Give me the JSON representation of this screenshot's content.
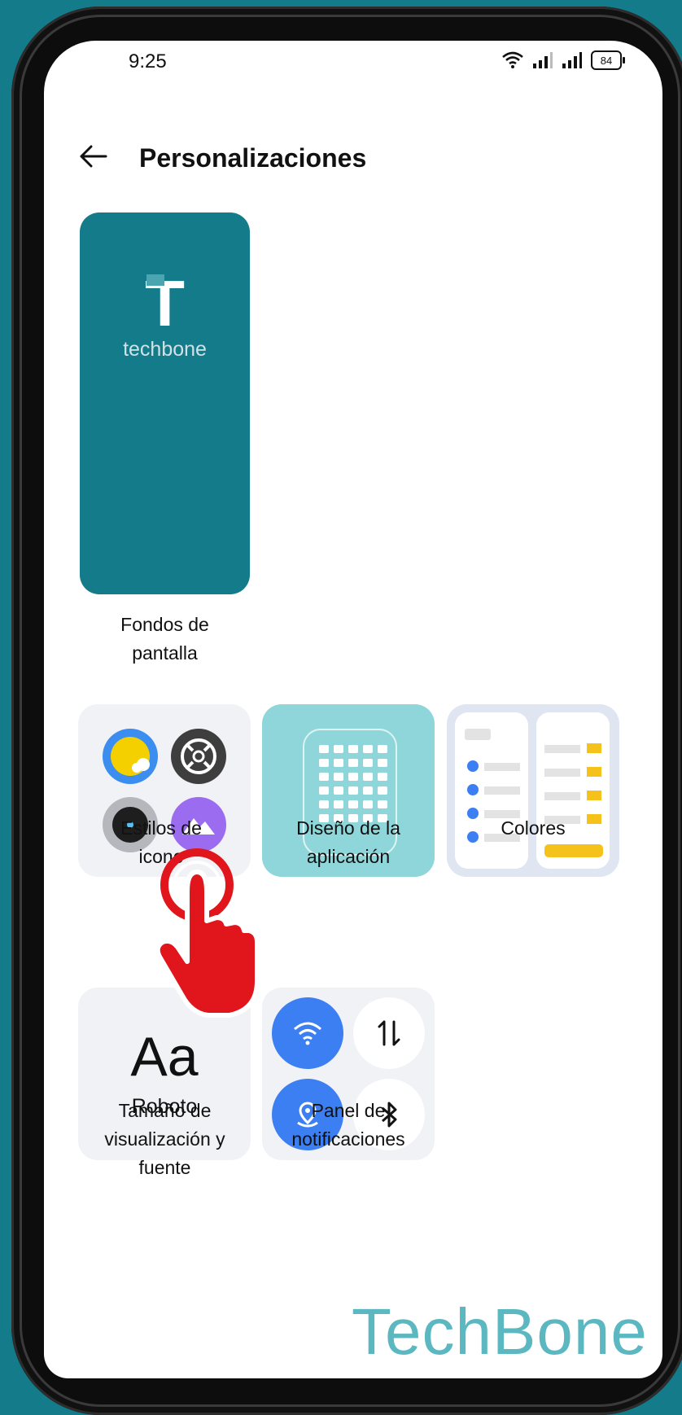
{
  "status_bar": {
    "time": "9:25",
    "battery": "84"
  },
  "header": {
    "title": "Personalizaciones"
  },
  "wallpaper": {
    "logo_letter": "T",
    "logo_word": "techbone",
    "label_line1": "Fondos de",
    "label_line2": "pantalla"
  },
  "icon_styles": {
    "label_line1": "Estilos de",
    "label_line2": "icono"
  },
  "app_design": {
    "label_line1": "Diseño de la",
    "label_line2": "aplicación"
  },
  "colors": {
    "label": "Colores"
  },
  "font_size": {
    "preview": "Aa",
    "font_name": "Roboto",
    "label_line1": "Tamaño de",
    "label_line2": "visualización y",
    "label_line3": "fuente"
  },
  "notification_panel": {
    "label_line1": "Panel de",
    "label_line2": "notificaciones"
  },
  "watermark": {
    "text": "TechBone"
  },
  "palette": {
    "accent_blue": "#3b7ff2",
    "teal": "#137b8a",
    "yellow": "#f5c21b",
    "hand_red": "#e0161c"
  }
}
